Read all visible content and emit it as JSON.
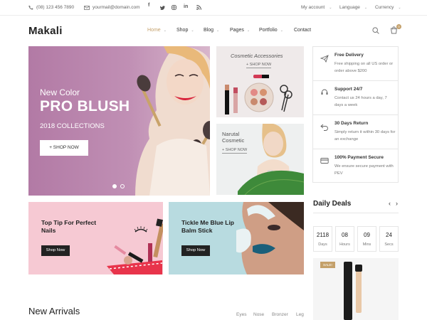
{
  "topbar": {
    "phone": "(08) 123 456 7890",
    "email": "yourmail@domain.com",
    "social": [
      "facebook-icon",
      "twitter-icon",
      "instagram-icon",
      "linkedin-icon",
      "rss-icon"
    ],
    "account": "My account",
    "language": "Language",
    "currency": "Currency"
  },
  "header": {
    "logo_mark": "M",
    "logo_text": "akali",
    "nav": [
      "Home",
      "Shop",
      "Blog",
      "Pages",
      "Portfolio",
      "Contact"
    ],
    "cart_count": "0",
    "accent": "#c4a06a"
  },
  "hero": {
    "line1": "New Color",
    "line2": "PRO BLUSH",
    "line3": "2018 COLLECTIONS",
    "cta": "+ SHOP NOW"
  },
  "categories": [
    {
      "title": "Cosmetic Accessories",
      "link": "+ SHOP NOW"
    },
    {
      "title_line1": "Narutal",
      "title_line2": "Cosmetic",
      "link": "+ SHOP NOW"
    }
  ],
  "features": [
    {
      "icon": "plane-icon",
      "title": "Free Delivery",
      "desc": "Free shipping on all US order or order above $200"
    },
    {
      "icon": "support-icon",
      "title": "Support 24/7",
      "desc": "Contact us 24 hours a day, 7 days a week"
    },
    {
      "icon": "return-icon",
      "title": "30 Days Return",
      "desc": "Simply return it within 30 days for an exchange"
    },
    {
      "icon": "credit-card-icon",
      "title": "100% Payment Secure",
      "desc": "We ensure secure payment with PEV"
    }
  ],
  "promos": [
    {
      "title": "Top Tip For Perfect Nails",
      "cta": "Shop Now"
    },
    {
      "title": "Tickle Me Blue Lip Balm Stick",
      "cta": "Shop Now"
    }
  ],
  "daily_deals": {
    "title": "Daily Deals",
    "countdown": [
      {
        "value": "2118",
        "label": "Days"
      },
      {
        "value": "08",
        "label": "Hours"
      },
      {
        "value": "09",
        "label": "Mins"
      },
      {
        "value": "24",
        "label": "Secs"
      }
    ],
    "sale_badge": "SALE!"
  },
  "new_arrivals": {
    "title": "New Arrivals",
    "filters": [
      "Eyes",
      "Nose",
      "Bronzer",
      "Leg"
    ]
  }
}
